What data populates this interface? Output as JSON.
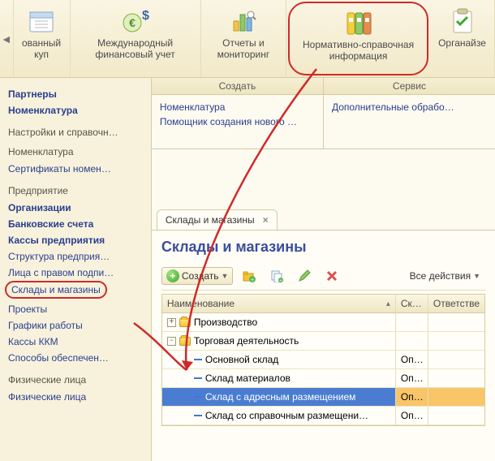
{
  "topbar": {
    "items": [
      {
        "label": "ованный\nкуп"
      },
      {
        "label": "Международный\nфинансовый учет"
      },
      {
        "label": "Отчеты и\nмониторинг"
      },
      {
        "label": "Нормативно-справочная\nинформация"
      },
      {
        "label": "Органайзе"
      }
    ]
  },
  "sidebar": {
    "top": [
      {
        "label": "Партнеры",
        "bold": true
      },
      {
        "label": "Номенклатура",
        "bold": true
      }
    ],
    "groups": [
      {
        "title": "Настройки и справочн…",
        "items": []
      },
      {
        "title": "Номенклатура",
        "items": [
          {
            "label": "Сертификаты номен…"
          }
        ]
      },
      {
        "title": "Предприятие",
        "items": [
          {
            "label": "Организации",
            "bold": true
          },
          {
            "label": "Банковские счета",
            "bold": true
          },
          {
            "label": "Кассы предприятия",
            "bold": true
          },
          {
            "label": "Структура предприя…"
          },
          {
            "label": "Лица с правом подпи…"
          },
          {
            "label": "Склады и магазины",
            "highlight": true
          },
          {
            "label": "Проекты"
          },
          {
            "label": "Графики работы"
          },
          {
            "label": "Кассы ККМ"
          },
          {
            "label": "Способы обеспечен…"
          }
        ]
      },
      {
        "title": "Физические лица",
        "items": [
          {
            "label": "Физические лица"
          }
        ]
      }
    ]
  },
  "boxes": {
    "create_header": "Создать",
    "service_header": "Сервис",
    "create_links": [
      "Номенклатура",
      "Помощник создания нового …"
    ],
    "service_links": [
      "Дополнительные обрабо…"
    ]
  },
  "tab": {
    "label": "Склады и магазины"
  },
  "page": {
    "title": "Склады и магазины",
    "toolbar": {
      "create": "Создать",
      "all_actions": "Все действия"
    },
    "columns": {
      "name": "Наименование",
      "sk": "Ск…",
      "resp": "Ответстве"
    },
    "rows": [
      {
        "toggle": "+",
        "type": "folder",
        "indent": 0,
        "name": "Производство",
        "sk": "",
        "resp": ""
      },
      {
        "toggle": "-",
        "type": "folder",
        "indent": 0,
        "name": "Торговая деятельность",
        "sk": "",
        "resp": ""
      },
      {
        "toggle": "",
        "type": "item",
        "indent": 1,
        "name": "Основной склад",
        "sk": "Оп…",
        "resp": ""
      },
      {
        "toggle": "",
        "type": "item",
        "indent": 1,
        "name": "Склад материалов",
        "sk": "Оп…",
        "resp": ""
      },
      {
        "toggle": "",
        "type": "item",
        "indent": 1,
        "name": "Склад с адресным размещением",
        "sk": "Оп…",
        "resp": "",
        "selected": true
      },
      {
        "toggle": "",
        "type": "item",
        "indent": 1,
        "name": "Склад со справочным размещени…",
        "sk": "Оп…",
        "resp": ""
      }
    ]
  }
}
